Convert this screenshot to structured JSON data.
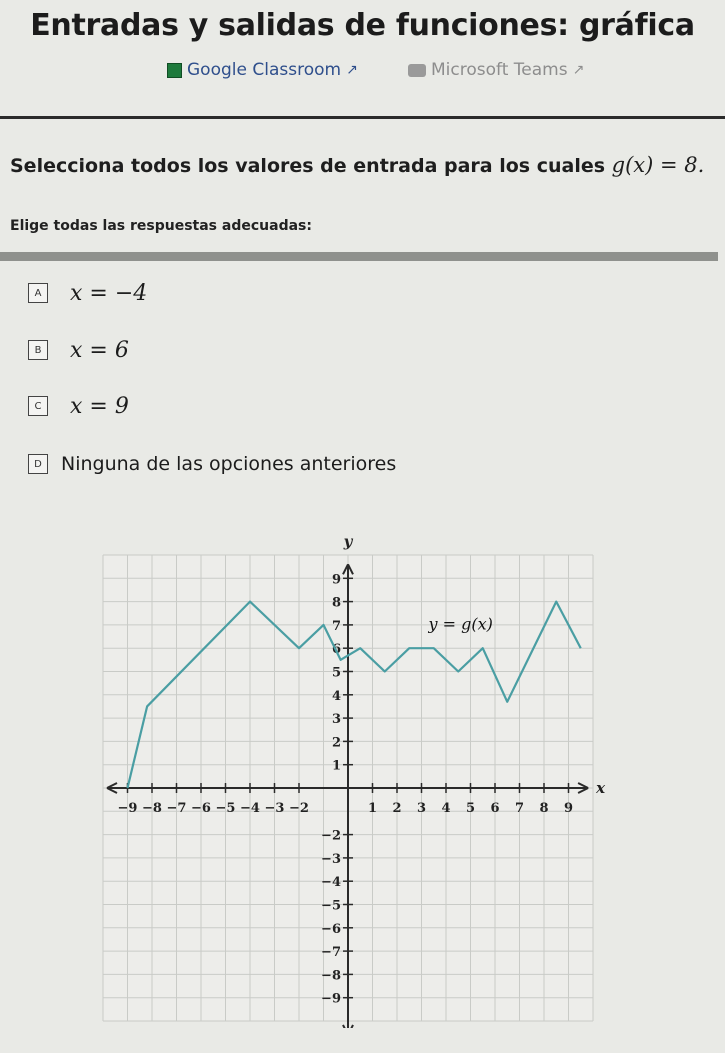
{
  "page_title": "Entradas y salidas de funciones: gráfica",
  "links": {
    "google_classroom": "Google Classroom",
    "microsoft_teams": "Microsoft Teams"
  },
  "question": {
    "prefix": "Selecciona todos los valores de entrada para los cuales",
    "math": "g(x) = 8."
  },
  "instruction": "Elige todas las respuestas adecuadas:",
  "options": [
    {
      "letter": "A",
      "text": "x = −4"
    },
    {
      "letter": "B",
      "text": "x = 6"
    },
    {
      "letter": "C",
      "text": "x = 9"
    },
    {
      "letter": "D",
      "text": "Ninguna de las opciones anteriores"
    }
  ],
  "icons": {
    "google_classroom": "classroom-icon",
    "microsoft_teams": "teams-icon",
    "external_link": "external-link-icon"
  },
  "colors": {
    "curve": "#4a9ea3",
    "grid": "#c9cbc7",
    "axis": "#2a2a2a",
    "link": "#2f4f8c"
  },
  "chart_data": {
    "type": "line",
    "xlabel": "x",
    "ylabel": "y",
    "curve_label": "y = g(x)",
    "xlim": [
      -10,
      10
    ],
    "ylim": [
      -10,
      10
    ],
    "grid": true,
    "x_ticks": [
      -9,
      -8,
      -7,
      -6,
      -5,
      -4,
      -3,
      -2,
      1,
      2,
      3,
      4,
      5,
      6,
      7,
      8,
      9
    ],
    "y_ticks": [
      9,
      8,
      7,
      6,
      5,
      4,
      3,
      2,
      1,
      -2,
      -3,
      -4,
      -5,
      -6,
      -7,
      -8,
      -9
    ],
    "series": [
      {
        "x": [
          -9,
          -8.2,
          -4,
          -2,
          -1,
          -0.3,
          0.5,
          1.5,
          2.5,
          3.5,
          4.5,
          5.5,
          6.5,
          8.5,
          9.5
        ],
        "y": [
          0,
          3.5,
          8,
          6,
          7,
          5.5,
          6,
          5,
          6,
          6,
          5,
          6,
          3.7,
          8,
          6
        ]
      }
    ]
  }
}
